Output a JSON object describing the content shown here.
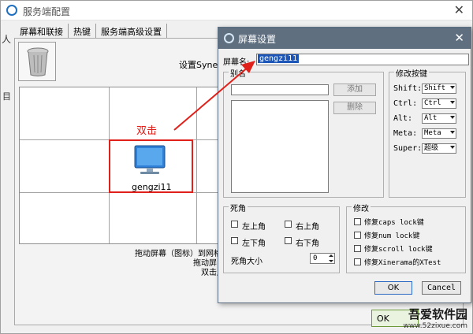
{
  "main_window": {
    "title": "服务端配置",
    "left_edge_chars": [
      "人",
      "目"
    ],
    "tabs": [
      "屏幕和联接",
      "热键",
      "服务端高级设置"
    ],
    "config_hint": "设置Synergy",
    "annotation_label": "双击",
    "screen_tile_label": "gengzi11",
    "bottom_hint_lines": [
      "拖动屏幕（图标）到网格中",
      "拖动屏",
      "双击屏"
    ],
    "ok_button_label": "OK"
  },
  "watermark": {
    "title": "吾爱软件园",
    "url": "www.52zixue.com"
  },
  "dialog": {
    "title": "屏幕设置",
    "screen_name_label": "屏幕名:",
    "screen_name_value": "gengzi11",
    "alias_group": {
      "caption": "别名",
      "add_label": "添加",
      "remove_label": "删除"
    },
    "modifier_group": {
      "caption": "修改按键",
      "rows": [
        {
          "key": "Shift:",
          "value": "Shift"
        },
        {
          "key": "Ctrl:",
          "value": "Ctrl"
        },
        {
          "key": "Alt:",
          "value": "Alt"
        },
        {
          "key": "Meta:",
          "value": "Meta"
        },
        {
          "key": "Super:",
          "value": "超级"
        }
      ]
    },
    "dead_corner_group": {
      "caption": "死角",
      "corners": [
        "左上角",
        "右上角",
        "左下角",
        "右下角"
      ],
      "size_label": "死角大小",
      "size_value": "0"
    },
    "fix_group": {
      "caption": "修改",
      "options": [
        "修复caps lock键",
        "修复num lock键",
        "修复scroll lock键",
        "修复Xinerama的XTest"
      ]
    },
    "ok_label": "OK",
    "cancel_label": "Cancel"
  },
  "colors": {
    "annotation_red": "#e0201a",
    "dialog_titlebar": "#5f6f80",
    "selection_blue": "#1b56b8"
  }
}
